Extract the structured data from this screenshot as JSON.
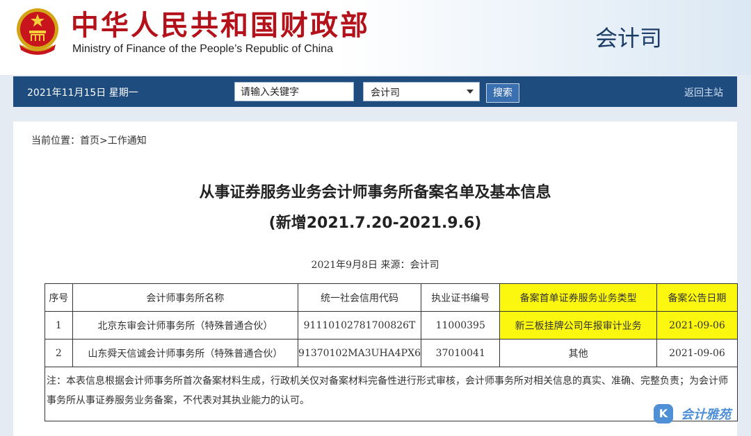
{
  "header": {
    "title_cn": "中华人民共和国财政部",
    "title_en": "Ministry of Finance of the People’s Republic of China",
    "department": "会计司"
  },
  "navbar": {
    "date": "2021年11月15日  星期一",
    "search_value": "请输入关键字",
    "select_value": "会计司",
    "search_button": "搜索",
    "home_link": "返回主站"
  },
  "breadcrumb": "当前位置：首页>工作通知",
  "article": {
    "title_line1": "从事证券服务业务会计师事务所备案名单及基本信息",
    "title_line2": "(新增2021.7.20-2021.9.6)",
    "meta": "2021年9月8日  来源：会计司"
  },
  "table": {
    "headers": [
      "序号",
      "会计师事务所名称",
      "统一社会信用代码",
      "执业证书编号",
      "备案首单证券服务业务类型",
      "备案公告日期"
    ],
    "rows": [
      [
        "1",
        "北京东审会计师事务所（特殊普通合伙）",
        "91110102781700826T",
        "11000395",
        "新三板挂牌公司年报审计业务",
        "2021-09-06"
      ],
      [
        "2",
        "山东舜天信诚会计师事务所（特殊普通合伙）",
        "91370102MA3UHA4PX6",
        "37010041",
        "其他",
        "2021-09-06"
      ]
    ],
    "note": "注：本表信息根据会计师事务所首次备案材料生成，行政机关仅对备案材料完备性进行形式审核，会计师事务所对相关信息的真实、准确、完整负责；为会计师事务所从事证券服务业务备案，不代表对其执业能力的认可。"
  },
  "watermark": {
    "badge": "K",
    "text": "会计雅苑"
  },
  "colors": {
    "brand_red": "#b3121b",
    "nav_blue": "#1f4c7f",
    "highlight": "#fbf70f"
  }
}
